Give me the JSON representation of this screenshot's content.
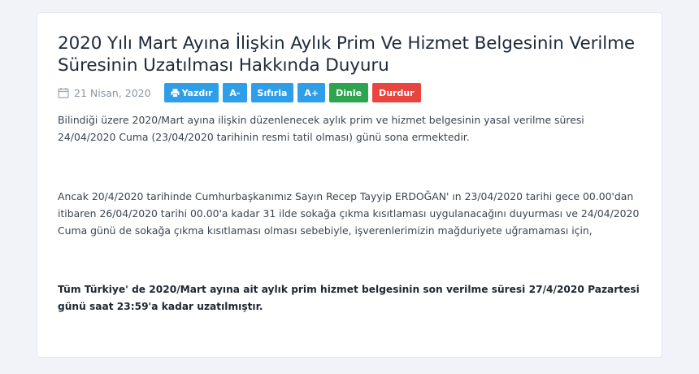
{
  "article": {
    "title": "2020 Yılı Mart Ayına İlişkin Aylık Prim Ve Hizmet Belgesinin Verilme Süresinin Uzatılması Hakkında Duyuru",
    "date": "21 Nisan, 2020",
    "icons": {
      "date": "calendar-icon",
      "print": "print-icon"
    },
    "toolbar": {
      "print_label": "Yazdır",
      "decrease_font_label": "A-",
      "reset_font_label": "Sıfırla",
      "increase_font_label": "A+",
      "listen_label": "Dinle",
      "stop_label": "Durdur"
    },
    "paragraphs": [
      "Bilindiği üzere 2020/Mart ayına ilişkin düzenlenecek aylık prim ve hizmet belgesinin yasal verilme süresi 24/04/2020 Cuma (23/04/2020 tarihinin resmi tatil olması) günü sona ermektedir.",
      "Ancak 20/4/2020 tarihinde Cumhurbaşkanımız Sayın Recep Tayyip ERDOĞAN' ın 23/04/2020 tarihi gece 00.00'dan itibaren 26/04/2020 tarihi 00.00'a kadar 31 ilde sokağa çıkma kısıtlaması uygulanacağını duyurması ve 24/04/2020 Cuma günü de sokağa çıkma kısıtlaması olması sebebiyle, işverenlerimizin mağduriyete uğramaması için,",
      "Tüm Türkiye' de 2020/Mart ayına ait aylık prim hizmet belgesinin son verilme süresi 27/4/2020 Pazartesi günü saat 23:59'a kadar uzatılmıştır."
    ],
    "colors": {
      "blue": "#2f9ee8",
      "green": "#2ea44f",
      "red": "#e9453f"
    }
  }
}
